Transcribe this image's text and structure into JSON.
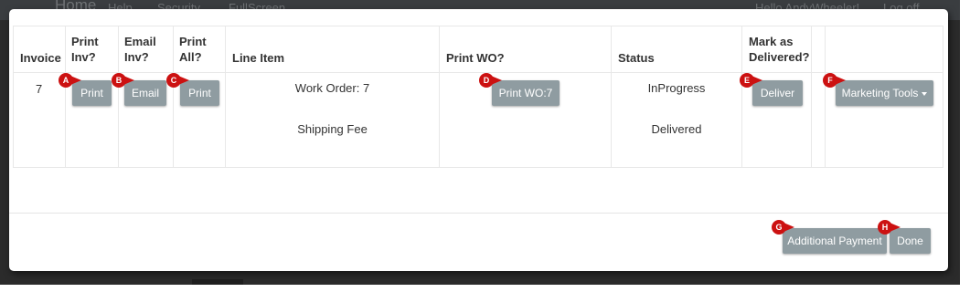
{
  "background_nav": {
    "home": "Home",
    "help": "Help",
    "security": "Security",
    "fullscreen": "FullScreen",
    "hello": "Hello AndyWheeler!",
    "logoff": "Log off"
  },
  "table": {
    "headers": {
      "invoice": "Invoice",
      "print_inv_1": "Print",
      "print_inv_2": "Inv?",
      "email_inv_1": "Email",
      "email_inv_2": "Inv?",
      "print_all_1": "Print",
      "print_all_2": "All?",
      "line_item": "Line Item",
      "print_wo": "Print WO?",
      "status": "Status",
      "mark_delivered_1": "Mark as",
      "mark_delivered_2": "Delivered?"
    },
    "row": {
      "invoice": "7",
      "print_label": "Print",
      "email_label": "Email",
      "print_all_label": "Print",
      "line_items": [
        "Work Order: 7",
        "Shipping Fee"
      ],
      "print_wo_label": "Print WO:7",
      "statuses": [
        "InProgress",
        "Delivered"
      ],
      "deliver_label": "Deliver",
      "marketing_label": "Marketing Tools"
    }
  },
  "footer": {
    "additional_payment": "Additional Payment",
    "done": "Done"
  },
  "callouts": [
    "A",
    "B",
    "C",
    "D",
    "E",
    "F",
    "G",
    "H"
  ],
  "colors": {
    "button_bg": "#8f9ca1",
    "callout": "#cc1111"
  }
}
